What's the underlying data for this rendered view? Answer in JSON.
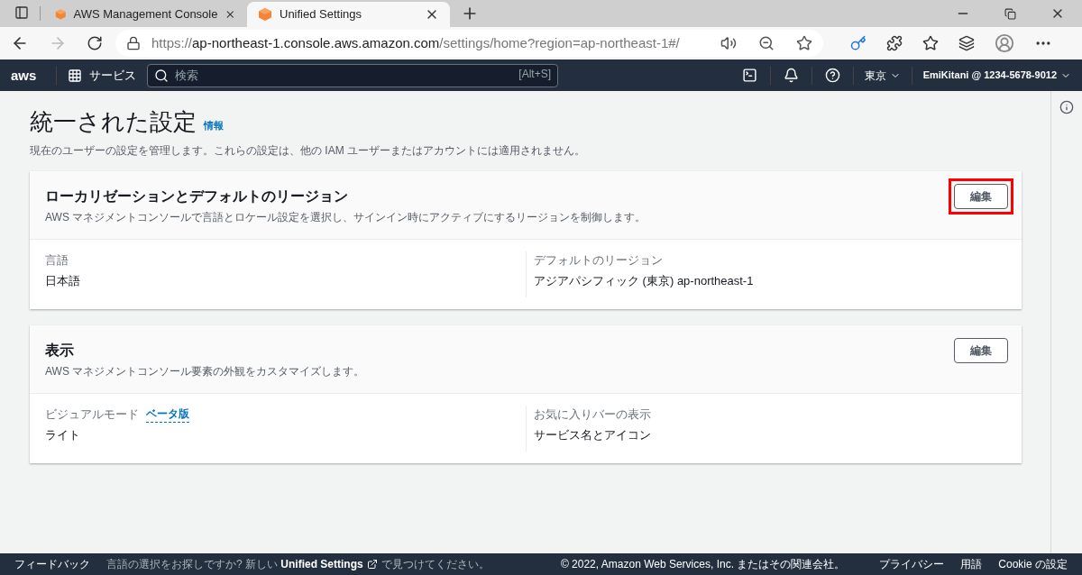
{
  "browser": {
    "tabs": [
      {
        "title": "AWS Management Console",
        "selected": false
      },
      {
        "title": "Unified Settings",
        "selected": true
      }
    ],
    "url": {
      "scheme": "https://",
      "domain": "ap-northeast-1.console.aws.amazon.com",
      "path": "/settings/home?region=ap-northeast-1#/"
    }
  },
  "aws_nav": {
    "logo": "aws",
    "services": "サービス",
    "search": {
      "placeholder": "検索",
      "shortcut": "[Alt+S]"
    },
    "region": "東京",
    "account": "EmiKitani @ 1234-5678-9012"
  },
  "page": {
    "title": "統一された設定",
    "info_link": "情報",
    "description": "現在のユーザーの設定を管理します。これらの設定は、他の IAM ユーザーまたはアカウントには適用されません。"
  },
  "sections": [
    {
      "title": "ローカリゼーションとデフォルトのリージョン",
      "description": "AWS マネジメントコンソールで言語とロケール設定を選択し、サインイン時にアクティブにするリージョンを制御します。",
      "edit_button": "編集",
      "highlighted": true,
      "fields": [
        {
          "label": "言語",
          "value": "日本語"
        },
        {
          "label": "デフォルトのリージョン",
          "value": "アジアパシフィック (東京) ap-northeast-1"
        }
      ]
    },
    {
      "title": "表示",
      "description": "AWS マネジメントコンソール要素の外観をカスタマイズします。",
      "edit_button": "編集",
      "highlighted": false,
      "fields": [
        {
          "label": "ビジュアルモード",
          "badge": "ベータ版",
          "value": "ライト"
        },
        {
          "label": "お気に入りバーの表示",
          "value": "サービス名とアイコン"
        }
      ]
    }
  ],
  "footer": {
    "feedback": "フィードバック",
    "notice": {
      "before": "言語の選択をお探しですか? 新しい",
      "link": "Unified Settings",
      "after": "で見つけてください。"
    },
    "copyright": "© 2022, Amazon Web Services, Inc. またはその関連会社。",
    "links": [
      "プライバシー",
      "用語",
      "Cookie の設定"
    ]
  }
}
